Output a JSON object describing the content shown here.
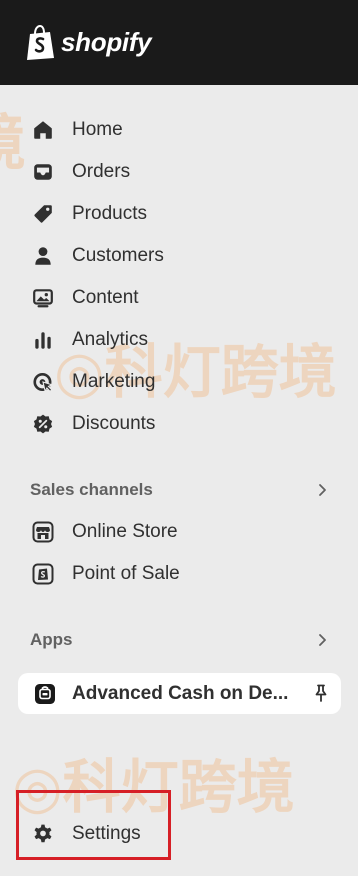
{
  "brand": {
    "name": "shopify"
  },
  "nav": {
    "items": [
      {
        "label": "Home",
        "icon": "home-icon"
      },
      {
        "label": "Orders",
        "icon": "inbox-icon"
      },
      {
        "label": "Products",
        "icon": "tag-icon"
      },
      {
        "label": "Customers",
        "icon": "person-icon"
      },
      {
        "label": "Content",
        "icon": "image-icon"
      },
      {
        "label": "Analytics",
        "icon": "bar-chart-icon"
      },
      {
        "label": "Marketing",
        "icon": "target-icon"
      },
      {
        "label": "Discounts",
        "icon": "discount-icon"
      }
    ]
  },
  "sales_channels": {
    "title": "Sales channels",
    "items": [
      {
        "label": "Online Store",
        "icon": "storefront-icon"
      },
      {
        "label": "Point of Sale",
        "icon": "pos-icon"
      }
    ]
  },
  "apps": {
    "title": "Apps",
    "items": [
      {
        "label": "Advanced Cash on De...",
        "icon": "app-icon",
        "pinned": true
      }
    ]
  },
  "settings": {
    "label": "Settings",
    "icon": "gear-icon"
  },
  "watermark": {
    "text": "科灯跨境"
  },
  "colors": {
    "topbar": "#1a1a1a",
    "sidebar": "#ebebeb",
    "highlight": "#d61f26"
  }
}
